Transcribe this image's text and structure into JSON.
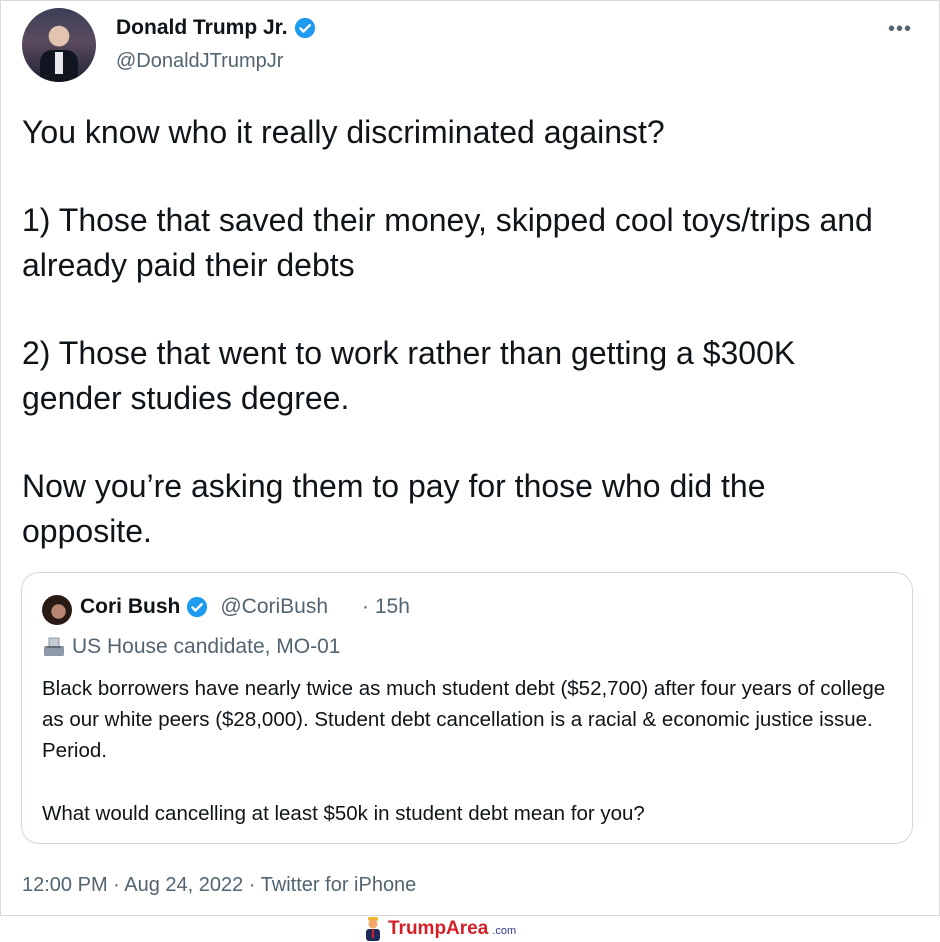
{
  "tweet": {
    "author_name": "Donald Trump Jr.",
    "author_handle": "@DonaldJTrumpJr",
    "more_icon": "more-horizontal-icon",
    "text": [
      "You know who it really discriminated against?",
      "1) Those that saved their money, skipped cool toys/trips and already paid their debts",
      "2) Those that went to work rather than getting a $300K gender studies degree.",
      "Now you’re asking them to pay for those who did the opposite."
    ],
    "meta": "12:00 PM · Aug 24, 2022 · Twitter for iPhone"
  },
  "quoted_tweet": {
    "author_name": "Cori Bush",
    "author_handle": "@CoriBush",
    "time": "· 15h",
    "label": "US House candidate, MO-01",
    "text": [
      "Black borrowers have nearly twice as much student debt ($52,700) after four years of college as our white peers ($28,000). Student debt cancellation is a racial & economic justice issue. Period.",
      "What would cancelling at least $50k in student debt mean for you?"
    ]
  },
  "watermark": {
    "brand": "TrumpArea",
    "tld": ".com"
  },
  "colors": {
    "verified": "#1d9bf0",
    "secondary_text": "#536471",
    "border": "#cfd9de",
    "watermark_red": "#d32027"
  }
}
